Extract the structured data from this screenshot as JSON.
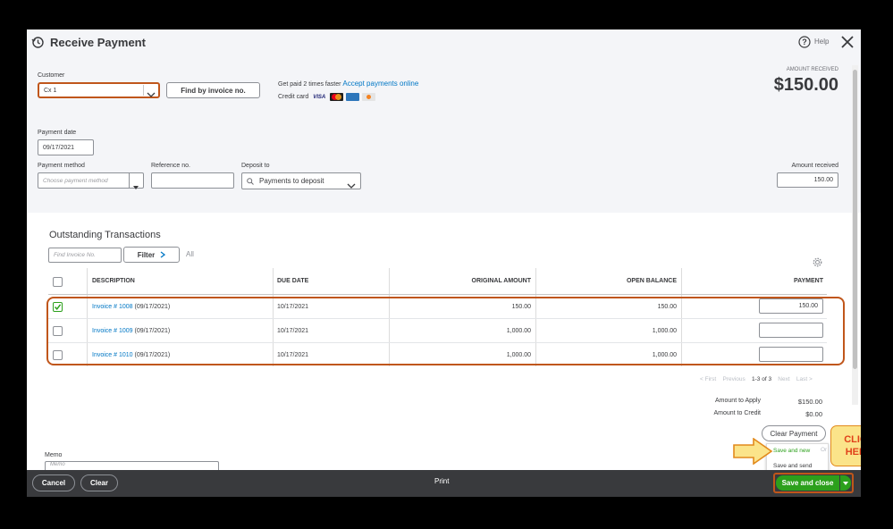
{
  "header": {
    "title": "Receive Payment",
    "help_label": "Help"
  },
  "customer": {
    "label": "Customer",
    "value": "Cx 1",
    "find_invoice_label": "Find by invoice no."
  },
  "promo": {
    "text": "Get paid 2 times faster",
    "link": "Accept payments online",
    "credit_card_label": "Credit card",
    "cards": [
      "VISA",
      "MC",
      "AMEX",
      "DISC"
    ]
  },
  "amount_received_top": {
    "label": "AMOUNT RECEIVED",
    "value": "$150.00"
  },
  "payment_date": {
    "label": "Payment date",
    "value": "09/17/2021"
  },
  "payment_method": {
    "label": "Payment method",
    "placeholder": "Choose payment method"
  },
  "reference": {
    "label": "Reference no.",
    "value": ""
  },
  "deposit_to": {
    "label": "Deposit to",
    "value": "Payments to deposit"
  },
  "amount_received_field": {
    "label": "Amount received",
    "value": "150.00"
  },
  "outstanding": {
    "title": "Outstanding Transactions",
    "find_placeholder": "Find Invoice No.",
    "filter_label": "Filter",
    "all_label": "All",
    "columns": {
      "description": "DESCRIPTION",
      "due_date": "DUE DATE",
      "original_amount": "ORIGINAL AMOUNT",
      "open_balance": "OPEN BALANCE",
      "payment": "PAYMENT"
    },
    "rows": [
      {
        "checked": true,
        "invoice": "Invoice # 1008",
        "date": "(09/17/2021)",
        "due": "10/17/2021",
        "original": "150.00",
        "open": "150.00",
        "payment": "150.00"
      },
      {
        "checked": false,
        "invoice": "Invoice # 1009",
        "date": "(09/17/2021)",
        "due": "10/17/2021",
        "original": "1,000.00",
        "open": "1,000.00",
        "payment": ""
      },
      {
        "checked": false,
        "invoice": "Invoice # 1010",
        "date": "(09/17/2021)",
        "due": "10/17/2021",
        "original": "1,000.00",
        "open": "1,000.00",
        "payment": ""
      }
    ],
    "pagination": {
      "first": "< First",
      "previous": "Previous",
      "range": "1-3 of 3",
      "next": "Next",
      "last": "Last >"
    }
  },
  "totals": {
    "apply_label": "Amount to Apply",
    "apply_value": "$150.00",
    "credit_label": "Amount to Credit",
    "credit_value": "$0.00",
    "clear_payment_label": "Clear Payment"
  },
  "memo": {
    "label": "Memo",
    "placeholder": "Memo"
  },
  "save_menu": {
    "save_new": "Save and new",
    "save_send": "Save and send",
    "or_partial": "Or"
  },
  "callout": {
    "text": "CLICK HERE"
  },
  "footer": {
    "cancel_label": "Cancel",
    "clear_label": "Clear",
    "print_label": "Print",
    "save_close_label": "Save and close"
  },
  "colors": {
    "accent_green": "#2ca01c",
    "link_blue": "#0077c5",
    "highlight_orange": "#c0561b",
    "callout_yellow": "#fbe48a",
    "footer_dark": "#393a3d"
  }
}
